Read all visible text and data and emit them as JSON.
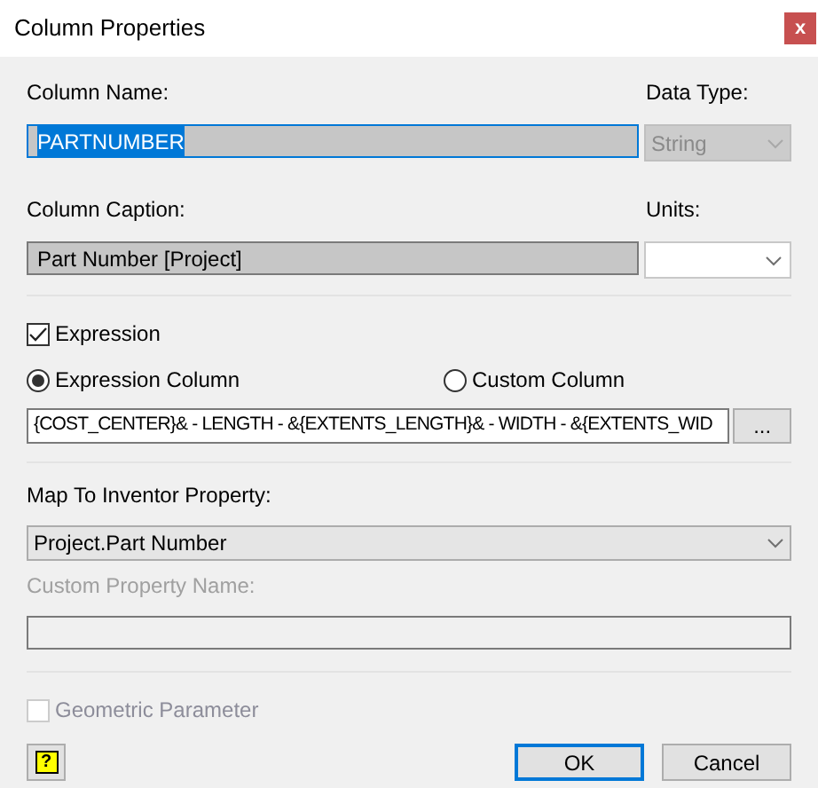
{
  "window": {
    "title": "Column Properties",
    "close": "x"
  },
  "column_name": {
    "label": "Column Name:",
    "value": "PARTNUMBER",
    "selected": true
  },
  "data_type": {
    "label": "Data Type:",
    "value": "String",
    "disabled": true
  },
  "column_caption": {
    "label": "Column Caption:",
    "value": "Part Number [Project]"
  },
  "units": {
    "label": "Units:"
  },
  "expression": {
    "label": "Expression",
    "checked": true
  },
  "column_kind": [
    {
      "label": "Expression Column",
      "selected": true
    },
    {
      "label": "Custom Column",
      "selected": false
    }
  ],
  "expression_field": {
    "value": "{COST_CENTER}& - LENGTH - &{EXTENTS_LENGTH}& - WIDTH - &{EXTENTS_WID",
    "browse": "..."
  },
  "map_property": {
    "label": "Map To Inventor Property:",
    "value": "Project.Part Number"
  },
  "custom_property": {
    "label": "Custom Property Name:",
    "disabled": true
  },
  "geometric_parameter": {
    "label": "Geometric Parameter",
    "checked": false,
    "disabled": true
  },
  "help": {
    "label": "?"
  },
  "buttons": [
    {
      "label": "OK",
      "selected": true
    },
    {
      "label": "Cancel",
      "selected": false
    }
  ]
}
